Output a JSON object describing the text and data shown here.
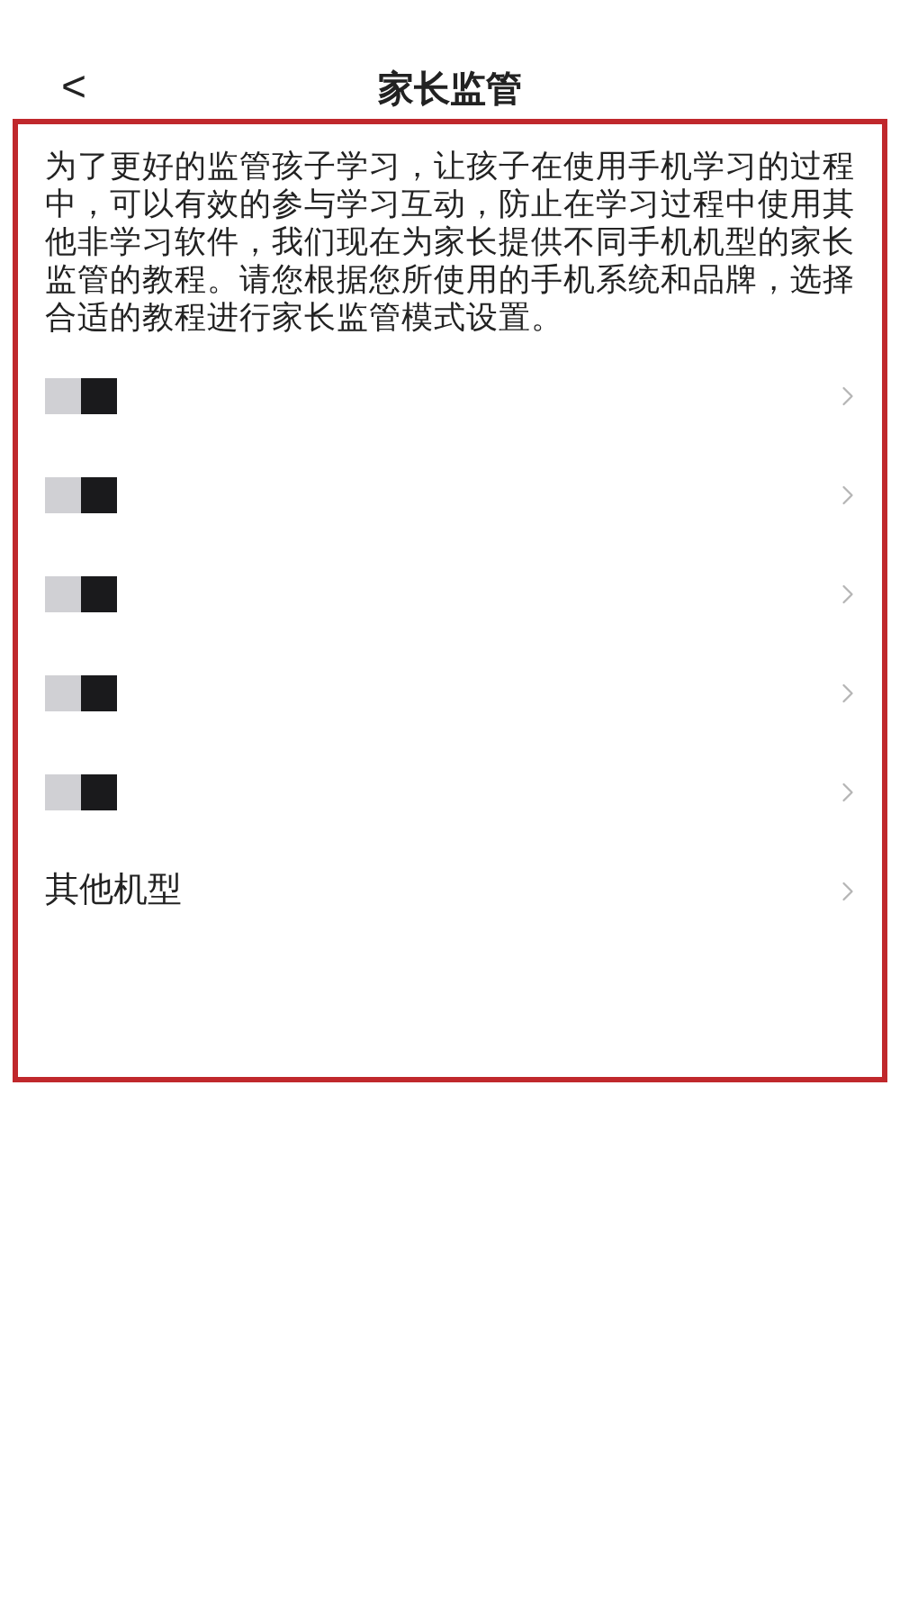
{
  "header": {
    "back": "<",
    "title": "家长监管"
  },
  "intro": "为了更好的监管孩子学习，让孩子在使用手机学习的过程中，可以有效的参与学习互动，防止在学习过程中使用其他非学习软件，我们现在为家长提供不同手机机型的家长监管的教程。请您根据您所使用的手机系统和品牌，选择合适的教程进行家长监管模式设置。",
  "items": [
    {
      "kind": "masked"
    },
    {
      "kind": "masked"
    },
    {
      "kind": "masked"
    },
    {
      "kind": "masked"
    },
    {
      "kind": "masked"
    },
    {
      "kind": "text",
      "label": "其他机型"
    }
  ]
}
